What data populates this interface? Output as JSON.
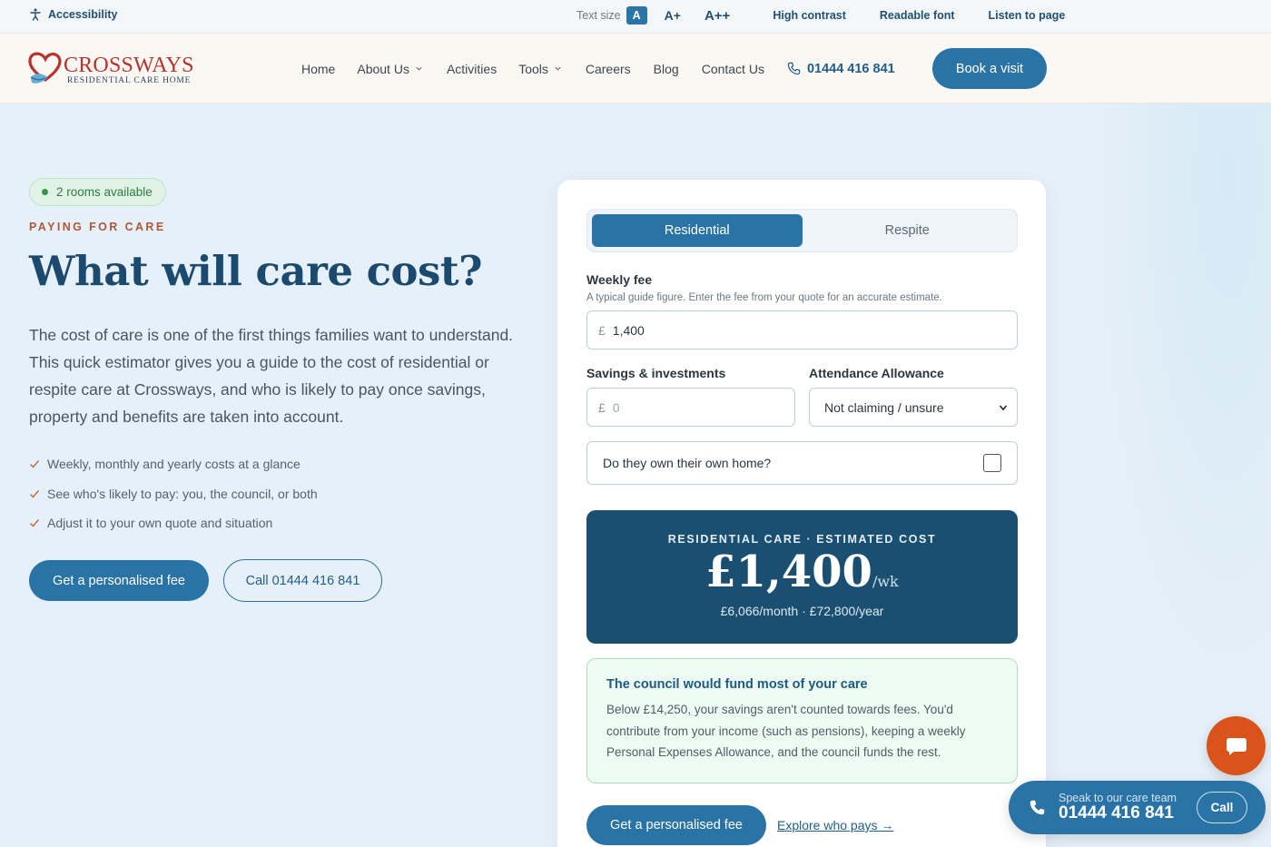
{
  "utility": {
    "accessibility": "Accessibility",
    "text_size_label": "Text size",
    "text_size_options": [
      "A",
      "A+",
      "A++"
    ],
    "high_contrast": "High contrast",
    "readable_font": "Readable font",
    "listen": "Listen to page"
  },
  "header": {
    "logo_name": "CROSSWAYS",
    "logo_sub": "RESIDENTIAL CARE HOME",
    "nav": [
      "Home",
      "About Us",
      "Activities",
      "Tools",
      "Careers",
      "Blog",
      "Contact Us"
    ],
    "phone": "01444 416 841",
    "book_button": "Book a visit"
  },
  "hero": {
    "availability": "2 rooms available",
    "eyebrow": "PAYING FOR CARE",
    "title": "What will care cost?",
    "intro": "The cost of care is one of the first things families want to understand. This quick estimator gives you a guide to the cost of residential or respite care at Crossways, and who is likely to pay once savings, property and benefits are taken into account.",
    "benefits": [
      "Weekly, monthly and yearly costs at a glance",
      "See who's likely to pay: you, the council, or both",
      "Adjust it to your own quote and situation"
    ],
    "cta_primary": "Get a personalised fee",
    "cta_secondary": "Call 01444 416 841"
  },
  "calculator": {
    "tabs": [
      "Residential",
      "Respite"
    ],
    "active_tab": "Residential",
    "weekly_fee_label": "Weekly fee",
    "weekly_fee_hint": "A typical guide figure. Enter the fee from your quote for an accurate estimate.",
    "currency": "£",
    "weekly_fee_value": "1,400",
    "savings_label": "Savings & investments",
    "savings_placeholder": "0",
    "attendance_label": "Attendance Allowance",
    "attendance_value": "Not claiming / unsure",
    "own_home_label": "Do they own their own home?",
    "own_home_checked": false,
    "result_eyebrow": "RESIDENTIAL CARE · ESTIMATED COST",
    "result_amount": "£1,400",
    "result_unit": "/wk",
    "result_sub": "£6,066/month · £72,800/year",
    "notice_title": "The council would fund most of your care",
    "notice_body": "Below £14,250, your savings aren't counted towards fees. You'd contribute from your income (such as pensions), keeping a weekly Personal Expenses Allowance, and the council funds the rest.",
    "cta": "Get a personalised fee",
    "link": "Explore who pays →"
  },
  "floating": {
    "call_sub": "Speak to our care team",
    "call_number": "01444 416 841",
    "call_button": "Call"
  },
  "colors": {
    "primary": "#2a73a6",
    "navy": "#1b4f72",
    "accent_red": "#b8332e",
    "chat_orange": "#d9531a",
    "success_green": "#2f9a4d"
  }
}
